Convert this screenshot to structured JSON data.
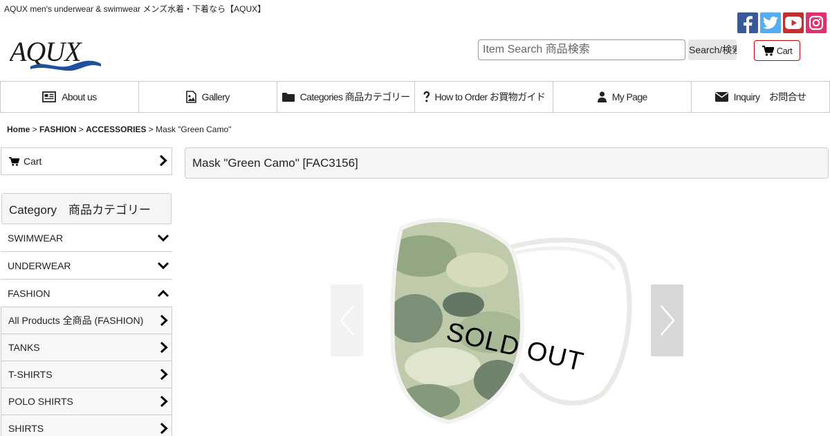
{
  "header": {
    "tagline": "AQUX men's underwear & swimwear メンズ水着・下着なら【AQUX】",
    "logo_text": "AQUX",
    "search_placeholder": "Item Search 商品検索",
    "search_button": "Search/検索",
    "cart_label": "Cart",
    "social": [
      "facebook-icon",
      "twitter-icon",
      "youtube-icon",
      "instagram-icon"
    ]
  },
  "nav": {
    "items": [
      {
        "label": "About us",
        "icon": "newspaper-icon"
      },
      {
        "label": "Gallery",
        "icon": "image-icon"
      },
      {
        "label": "Categories 商品カテゴリー",
        "icon": "folder-icon"
      },
      {
        "label": "How to Order お買物ガイド",
        "icon": "question-icon"
      },
      {
        "label": "My Page",
        "icon": "user-icon"
      },
      {
        "label": "Inquiry　お問合せ",
        "icon": "envelope-icon"
      }
    ]
  },
  "breadcrumb": {
    "home": "Home",
    "sep": ">",
    "level1": "FASHION",
    "level2": "ACCESSORIES",
    "current": "Mask \"Green Camo\""
  },
  "sidebar": {
    "cart_label": "Cart",
    "category_heading": "Category　商品カテゴリー",
    "categories": [
      {
        "label": "SWIMWEAR",
        "state": "collapsed"
      },
      {
        "label": "UNDERWEAR",
        "state": "collapsed"
      },
      {
        "label": "FASHION",
        "state": "expanded"
      }
    ],
    "subcategories": [
      "All Products 全商品 (FASHION)",
      "TANKS",
      "T-SHIRTS",
      "POLO SHIRTS",
      "SHIRTS"
    ]
  },
  "product": {
    "title": "Mask \"Green Camo\" [FAC3156]",
    "overlay": "SOLD OUT"
  },
  "colors": {
    "facebook": "#3b5998",
    "twitter": "#55acee",
    "youtube": "#c4302b",
    "instagram": "#e1306c",
    "cart_border": "#cc0000",
    "logo": "#1a1a1a",
    "logo_wave": "#1f4f9f"
  }
}
